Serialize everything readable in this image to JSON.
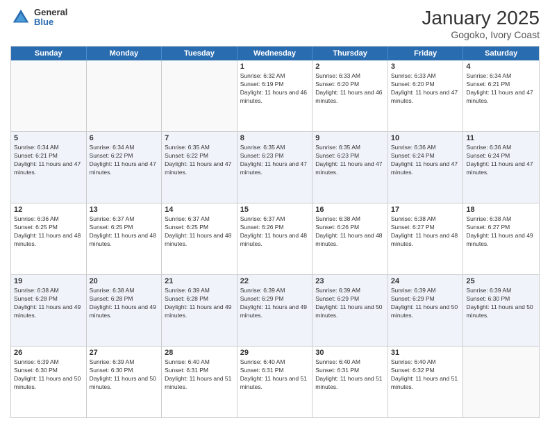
{
  "header": {
    "logo_general": "General",
    "logo_blue": "Blue",
    "month_year": "January 2025",
    "location": "Gogoko, Ivory Coast"
  },
  "days_of_week": [
    "Sunday",
    "Monday",
    "Tuesday",
    "Wednesday",
    "Thursday",
    "Friday",
    "Saturday"
  ],
  "weeks": [
    {
      "cells": [
        {
          "day": "",
          "empty": true
        },
        {
          "day": "",
          "empty": true
        },
        {
          "day": "",
          "empty": true
        },
        {
          "day": "1",
          "sunrise": "Sunrise: 6:32 AM",
          "sunset": "Sunset: 6:19 PM",
          "daylight": "Daylight: 11 hours and 46 minutes."
        },
        {
          "day": "2",
          "sunrise": "Sunrise: 6:33 AM",
          "sunset": "Sunset: 6:20 PM",
          "daylight": "Daylight: 11 hours and 46 minutes."
        },
        {
          "day": "3",
          "sunrise": "Sunrise: 6:33 AM",
          "sunset": "Sunset: 6:20 PM",
          "daylight": "Daylight: 11 hours and 47 minutes."
        },
        {
          "day": "4",
          "sunrise": "Sunrise: 6:34 AM",
          "sunset": "Sunset: 6:21 PM",
          "daylight": "Daylight: 11 hours and 47 minutes."
        }
      ]
    },
    {
      "cells": [
        {
          "day": "5",
          "sunrise": "Sunrise: 6:34 AM",
          "sunset": "Sunset: 6:21 PM",
          "daylight": "Daylight: 11 hours and 47 minutes."
        },
        {
          "day": "6",
          "sunrise": "Sunrise: 6:34 AM",
          "sunset": "Sunset: 6:22 PM",
          "daylight": "Daylight: 11 hours and 47 minutes."
        },
        {
          "day": "7",
          "sunrise": "Sunrise: 6:35 AM",
          "sunset": "Sunset: 6:22 PM",
          "daylight": "Daylight: 11 hours and 47 minutes."
        },
        {
          "day": "8",
          "sunrise": "Sunrise: 6:35 AM",
          "sunset": "Sunset: 6:23 PM",
          "daylight": "Daylight: 11 hours and 47 minutes."
        },
        {
          "day": "9",
          "sunrise": "Sunrise: 6:35 AM",
          "sunset": "Sunset: 6:23 PM",
          "daylight": "Daylight: 11 hours and 47 minutes."
        },
        {
          "day": "10",
          "sunrise": "Sunrise: 6:36 AM",
          "sunset": "Sunset: 6:24 PM",
          "daylight": "Daylight: 11 hours and 47 minutes."
        },
        {
          "day": "11",
          "sunrise": "Sunrise: 6:36 AM",
          "sunset": "Sunset: 6:24 PM",
          "daylight": "Daylight: 11 hours and 47 minutes."
        }
      ]
    },
    {
      "cells": [
        {
          "day": "12",
          "sunrise": "Sunrise: 6:36 AM",
          "sunset": "Sunset: 6:25 PM",
          "daylight": "Daylight: 11 hours and 48 minutes."
        },
        {
          "day": "13",
          "sunrise": "Sunrise: 6:37 AM",
          "sunset": "Sunset: 6:25 PM",
          "daylight": "Daylight: 11 hours and 48 minutes."
        },
        {
          "day": "14",
          "sunrise": "Sunrise: 6:37 AM",
          "sunset": "Sunset: 6:25 PM",
          "daylight": "Daylight: 11 hours and 48 minutes."
        },
        {
          "day": "15",
          "sunrise": "Sunrise: 6:37 AM",
          "sunset": "Sunset: 6:26 PM",
          "daylight": "Daylight: 11 hours and 48 minutes."
        },
        {
          "day": "16",
          "sunrise": "Sunrise: 6:38 AM",
          "sunset": "Sunset: 6:26 PM",
          "daylight": "Daylight: 11 hours and 48 minutes."
        },
        {
          "day": "17",
          "sunrise": "Sunrise: 6:38 AM",
          "sunset": "Sunset: 6:27 PM",
          "daylight": "Daylight: 11 hours and 48 minutes."
        },
        {
          "day": "18",
          "sunrise": "Sunrise: 6:38 AM",
          "sunset": "Sunset: 6:27 PM",
          "daylight": "Daylight: 11 hours and 49 minutes."
        }
      ]
    },
    {
      "cells": [
        {
          "day": "19",
          "sunrise": "Sunrise: 6:38 AM",
          "sunset": "Sunset: 6:28 PM",
          "daylight": "Daylight: 11 hours and 49 minutes."
        },
        {
          "day": "20",
          "sunrise": "Sunrise: 6:38 AM",
          "sunset": "Sunset: 6:28 PM",
          "daylight": "Daylight: 11 hours and 49 minutes."
        },
        {
          "day": "21",
          "sunrise": "Sunrise: 6:39 AM",
          "sunset": "Sunset: 6:28 PM",
          "daylight": "Daylight: 11 hours and 49 minutes."
        },
        {
          "day": "22",
          "sunrise": "Sunrise: 6:39 AM",
          "sunset": "Sunset: 6:29 PM",
          "daylight": "Daylight: 11 hours and 49 minutes."
        },
        {
          "day": "23",
          "sunrise": "Sunrise: 6:39 AM",
          "sunset": "Sunset: 6:29 PM",
          "daylight": "Daylight: 11 hours and 50 minutes."
        },
        {
          "day": "24",
          "sunrise": "Sunrise: 6:39 AM",
          "sunset": "Sunset: 6:29 PM",
          "daylight": "Daylight: 11 hours and 50 minutes."
        },
        {
          "day": "25",
          "sunrise": "Sunrise: 6:39 AM",
          "sunset": "Sunset: 6:30 PM",
          "daylight": "Daylight: 11 hours and 50 minutes."
        }
      ]
    },
    {
      "cells": [
        {
          "day": "26",
          "sunrise": "Sunrise: 6:39 AM",
          "sunset": "Sunset: 6:30 PM",
          "daylight": "Daylight: 11 hours and 50 minutes."
        },
        {
          "day": "27",
          "sunrise": "Sunrise: 6:39 AM",
          "sunset": "Sunset: 6:30 PM",
          "daylight": "Daylight: 11 hours and 50 minutes."
        },
        {
          "day": "28",
          "sunrise": "Sunrise: 6:40 AM",
          "sunset": "Sunset: 6:31 PM",
          "daylight": "Daylight: 11 hours and 51 minutes."
        },
        {
          "day": "29",
          "sunrise": "Sunrise: 6:40 AM",
          "sunset": "Sunset: 6:31 PM",
          "daylight": "Daylight: 11 hours and 51 minutes."
        },
        {
          "day": "30",
          "sunrise": "Sunrise: 6:40 AM",
          "sunset": "Sunset: 6:31 PM",
          "daylight": "Daylight: 11 hours and 51 minutes."
        },
        {
          "day": "31",
          "sunrise": "Sunrise: 6:40 AM",
          "sunset": "Sunset: 6:32 PM",
          "daylight": "Daylight: 11 hours and 51 minutes."
        },
        {
          "day": "",
          "empty": true
        }
      ]
    }
  ]
}
